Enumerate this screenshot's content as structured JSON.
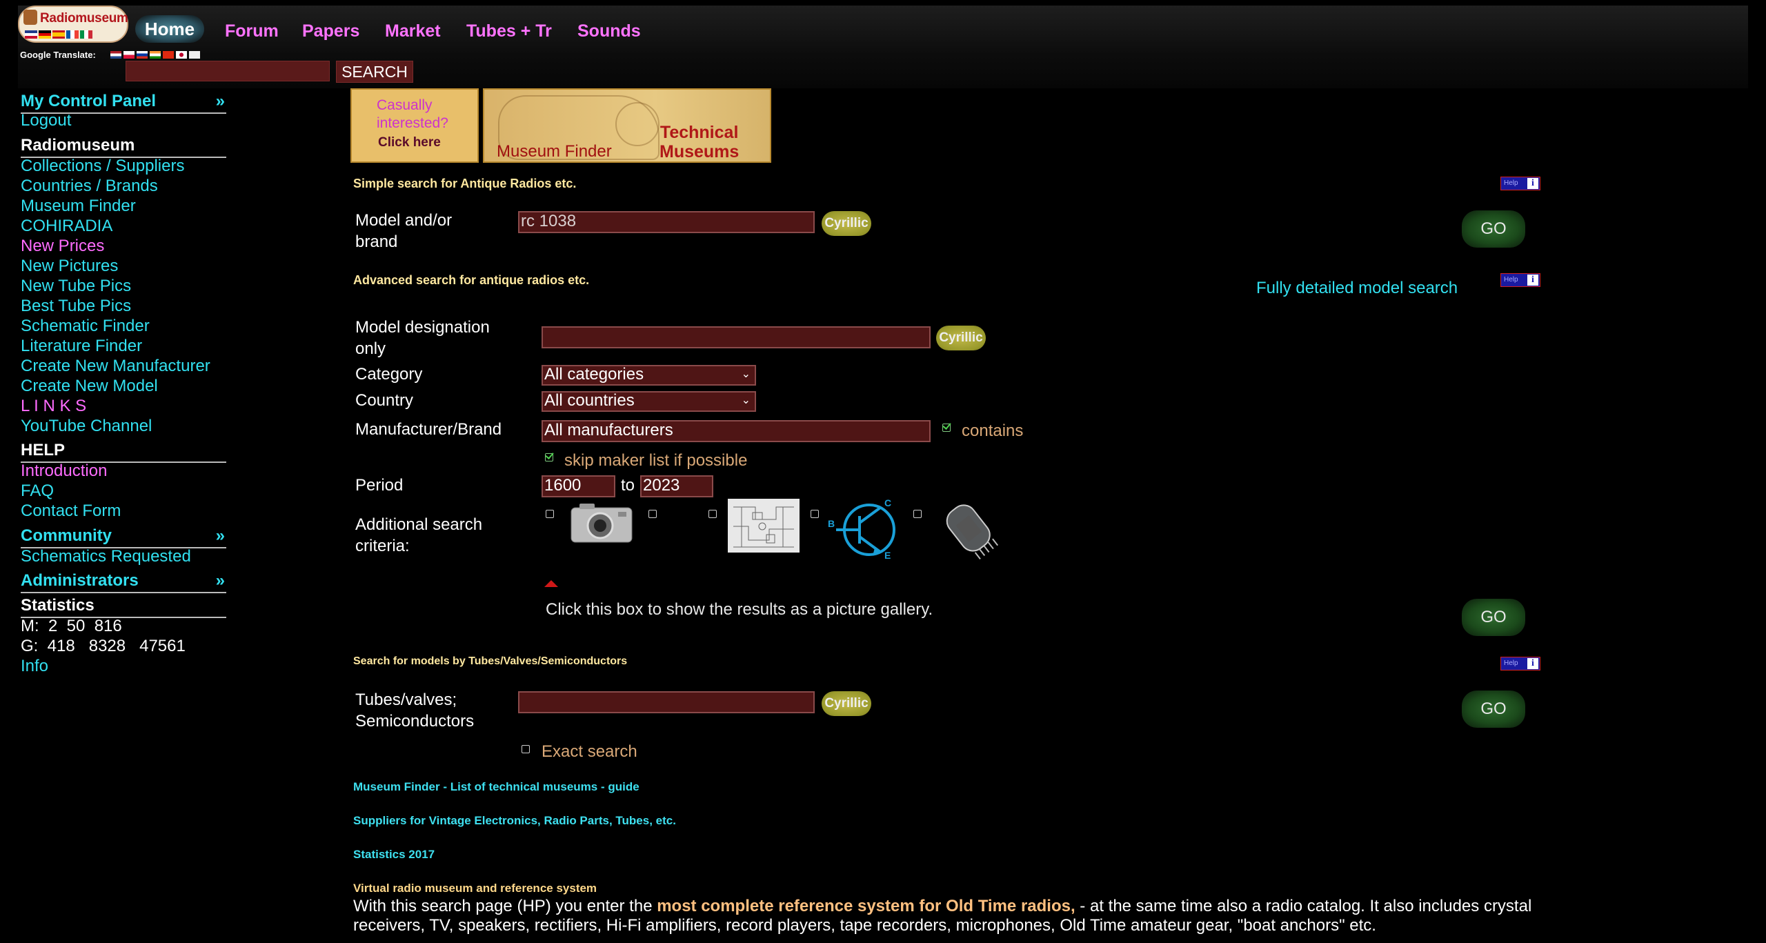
{
  "header": {
    "logo_text": "Radiomuseum",
    "google_translate_label": "Google Translate:",
    "nav": [
      "Home",
      "Forum",
      "Papers",
      "Market",
      "Tubes + Tr",
      "Sounds"
    ],
    "search_value": "",
    "search_button": "SEARCH"
  },
  "sidebar": {
    "control_panel": "My Control Panel",
    "control_panel_arrow": "»",
    "logout": "Logout",
    "radiomuseum_heading": "Radiomuseum",
    "links": [
      "Collections / Suppliers",
      "Countries / Brands",
      "Museum Finder",
      "COHIRADIA",
      "New Prices",
      "New Pictures",
      "New Tube Pics",
      "Best Tube Pics",
      "Schematic Finder",
      "Literature Finder",
      "Create New Manufacturer",
      "Create New Model",
      "L I N K S",
      "YouTube Channel"
    ],
    "help_heading": "HELP",
    "help_links": [
      "Introduction",
      "FAQ",
      "Contact Form"
    ],
    "community": "Community",
    "community_arrow": "»",
    "schematics_requested": "Schematics Requested",
    "administrators": "Administrators",
    "administrators_arrow": "»",
    "statistics_heading": "Statistics",
    "stat_m": "M:  2  50  816",
    "stat_g": "G:  418   8328   47561",
    "info": "Info"
  },
  "banners": {
    "casual_line1": "Casually",
    "casual_line2": "interested?",
    "casual_click": "Click here",
    "museum_finder": "Museum Finder",
    "technical_museums_1": "Technical",
    "technical_museums_2": "Museums"
  },
  "simple_search": {
    "title": "Simple search for Antique Radios etc.",
    "label_line1": "Model and/or",
    "label_line2": "brand",
    "value": "rc 1038",
    "cyrillic": "Cyrillic",
    "go": "GO",
    "help": "Help"
  },
  "advanced_search": {
    "title": "Advanced search for antique radios etc.",
    "fully_detailed": "Fully detailed model search",
    "model_label_1": "Model designation",
    "model_label_2": "only",
    "model_value": "",
    "cyrillic": "Cyrillic",
    "category_label": "Category",
    "category_value": "All categories",
    "country_label": "Country",
    "country_value": "All countries",
    "manufacturer_label": "Manufacturer/Brand",
    "manufacturer_value": "All manufacturers",
    "contains": "contains",
    "skip_maker": "skip maker list if possible",
    "period_label": "Period",
    "period_from": "1600",
    "period_to_word": "to",
    "period_to": "2023",
    "additional_1": "Additional search",
    "additional_2": "criteria:",
    "gallery_text": "Click this box to show the results as a picture gallery.",
    "go": "GO",
    "help": "Help"
  },
  "tube_search": {
    "title": "Search for models by Tubes/Valves/Semiconductors",
    "label_1": "Tubes/valves;",
    "label_2": "Semiconductors",
    "value": "",
    "cyrillic": "Cyrillic",
    "exact": "Exact search",
    "go": "GO",
    "help": "Help"
  },
  "footer_links": {
    "museum_finder": "Museum Finder - List of technical museums - guide",
    "suppliers": "Suppliers for Vintage Electronics, Radio Parts, Tubes, etc.",
    "statistics": "Statistics 2017",
    "virtual": "Virtual radio museum and reference system"
  },
  "intro": {
    "part1": "With this search page (HP) you enter the ",
    "highlight": "most complete reference system for Old Time radios,",
    "part2": " - at the same time also a radio catalog. It also includes crystal receivers, TV, speakers, rectifiers, Hi-Fi amplifiers, record players, tape recorders, microphones, Old Time amateur gear, \"boat anchors\" etc."
  },
  "colors": {
    "link_cyan": "#32e0f0",
    "link_pink": "#ff6cff",
    "field_bg": "#4f1515",
    "section_title": "#ffe8a0",
    "go_green": "#1b4a1b",
    "cyrillic_olive": "#9a9a2c"
  }
}
